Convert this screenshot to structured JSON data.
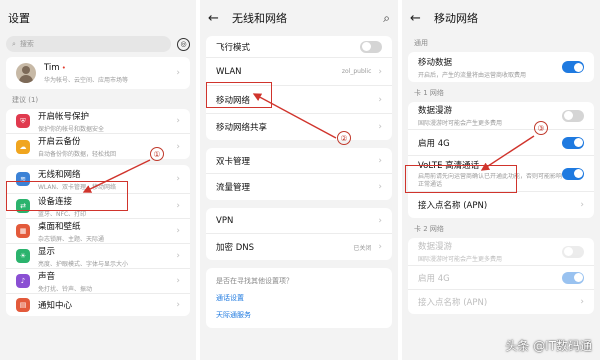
{
  "screen1": {
    "title": "设置",
    "search_placeholder": "搜索",
    "account": {
      "name": "Tim",
      "sub": "华为帐号、云空间、应用市场等"
    },
    "suggest_header": "建议 (1)",
    "suggest_items": [
      {
        "label": "开启帐号保护",
        "sub": "保护你的帐号和数据安全"
      }
    ],
    "items": [
      {
        "label": "开启云备份",
        "sub": "自动备份你的数据，轻松找回",
        "color": "#f0a51f",
        "icon": "cloud-backup-icon"
      },
      {
        "label": "无线和网络",
        "sub": "WLAN、双卡管理、移动网络",
        "color": "#3b82d6",
        "icon": "wifi-icon"
      },
      {
        "label": "设备连接",
        "sub": "蓝牙、NFC、打印",
        "color": "#2bb36d",
        "icon": "device-connect-icon"
      },
      {
        "label": "桌面和壁纸",
        "sub": "杂志锁屏、主题、天际通",
        "color": "#e35a3b",
        "icon": "wallpaper-icon"
      },
      {
        "label": "显示",
        "sub": "亮度、护眼模式、字体与显示大小",
        "color": "#2bb36d",
        "icon": "display-icon"
      },
      {
        "label": "声音",
        "sub": "免打扰、铃声、振动",
        "color": "#8a4fd3",
        "icon": "sound-icon"
      },
      {
        "label": "通知中心",
        "sub": "",
        "color": "#e35a3b",
        "icon": "notification-icon"
      }
    ],
    "callout": "①"
  },
  "screen2": {
    "title": "无线和网络",
    "items": [
      {
        "label": "飞行模式",
        "type": "toggle",
        "on": false
      },
      {
        "label": "WLAN",
        "value": "zol_public"
      },
      {
        "label": "移动网络"
      },
      {
        "label": "移动网络共享"
      },
      {
        "label": "双卡管理"
      },
      {
        "label": "流量管理"
      },
      {
        "label": "VPN"
      },
      {
        "label": "加密 DNS",
        "value": "已关闭"
      }
    ],
    "more_prompt": "是否在寻找其他设置项？",
    "links": [
      "通话设置",
      "天际通服务"
    ],
    "callout": "②"
  },
  "screen3": {
    "title": "移动网络",
    "general_header": "通用",
    "mobile_data": {
      "label": "移动数据",
      "sub": "开启后，产生的流量将由运营商收取费用",
      "on": true
    },
    "sim1_header": "卡 1 网络",
    "roaming": {
      "label": "数据漫游",
      "sub": "国际漫游时可能会产生更多费用",
      "on": false
    },
    "enable4g": {
      "label": "启用 4G",
      "on": true
    },
    "volte": {
      "label": "VoLTE 高清通话",
      "sub": "启用前请先向运营商确认已开通此功能，否则可能影响正常通话",
      "on": true
    },
    "apn": {
      "label": "接入点名称 (APN)"
    },
    "sim2_header": "卡 2 网络",
    "sim2_roaming": {
      "label": "数据漫游",
      "sub": "国际漫游时可能会产生更多费用"
    },
    "sim2_4g": {
      "label": "启用 4G"
    },
    "sim2_apn": {
      "label": "接入点名称 (APN)"
    },
    "callout": "③"
  },
  "watermark": "头条 @IT数码通",
  "colors": {
    "accent": "#1f7ae0",
    "annotation": "#d0342c"
  }
}
